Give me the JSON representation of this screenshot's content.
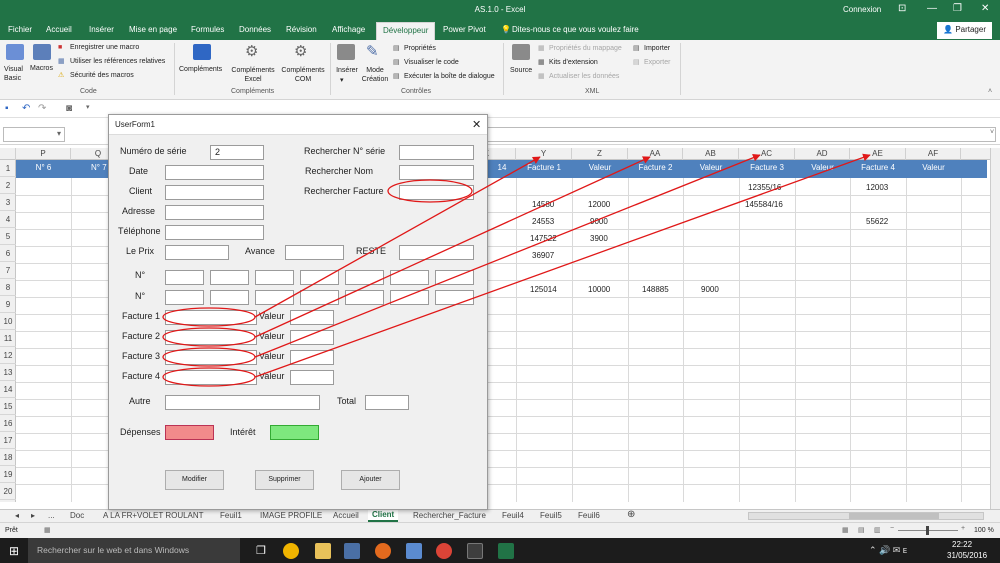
{
  "window": {
    "title": "AS.1.0 - Excel",
    "account": "Connexion",
    "controls": [
      "⊡",
      "—",
      "❐",
      "✕"
    ]
  },
  "ribbon_tabs": [
    "Fichier",
    "Accueil",
    "Insérer",
    "Mise en page",
    "Formules",
    "Données",
    "Révision",
    "Affichage",
    "Développeur",
    "Power Pivot",
    "Dites-nous ce que vous voulez faire"
  ],
  "share_label": "Partager",
  "ribbon": {
    "code": {
      "visual_basic": "Visual Basic",
      "macros": "Macros",
      "record": "Enregistrer une macro",
      "relative": "Utiliser les références relatives",
      "security": "Sécurité des macros",
      "group": "Code"
    },
    "addins": {
      "complements": "Compléments",
      "excel": "Compléments Excel",
      "com": "Compléments COM",
      "group": "Compléments"
    },
    "controls": {
      "insert": "Insérer",
      "design": "Mode Création",
      "properties": "Propriétés",
      "view_code": "Visualiser le code",
      "run_dialog": "Exécuter la boîte de dialogue",
      "group": "Contrôles"
    },
    "xml": {
      "source": "Source",
      "map_props": "Propriétés du mappage",
      "expansion": "Kits d'extension",
      "refresh": "Actualiser les données",
      "import": "Importer",
      "export": "Exporter",
      "group": "XML"
    }
  },
  "col_headers": [
    "P",
    "Q",
    "X",
    "Y",
    "Z",
    "AA",
    "AB",
    "AC",
    "AD",
    "AE",
    "AF"
  ],
  "row_numbers": [
    "1",
    "2",
    "3",
    "4",
    "5",
    "6",
    "7",
    "8",
    "9",
    "10",
    "11",
    "12",
    "13",
    "14",
    "15",
    "16",
    "17",
    "18",
    "19",
    "20"
  ],
  "header_cells": {
    "p": "N° 6",
    "q": "N° 7",
    "x": "14",
    "y": "Facture 1",
    "z": "Valeur",
    "aa": "Facture 2",
    "ab": "Valeur",
    "ac": "Facture 3",
    "ad": "Valeur",
    "ae": "Facture 4",
    "af": "Valeur"
  },
  "cells": {
    "ac2": "12355/16",
    "ae2": "12003",
    "y3": "14580",
    "z3": "12000",
    "ac3": "145584/16",
    "y4": "24553",
    "z4": "9000",
    "ae4": "55622",
    "y5": "147522",
    "z5": "3900",
    "y6": "36907",
    "y8": "125014",
    "z8": "10000",
    "aa8": "148885",
    "ab8": "9000"
  },
  "sheet_tabs": [
    "...",
    "Doc",
    "A LA FR+VOLET ROULANT",
    "Feuil1",
    "IMAGE PROFILE",
    "Accueil",
    "Client",
    "Rechercher_Facture",
    "Feuil4",
    "Feuil5",
    "Feuil6"
  ],
  "active_sheet": "Client",
  "status": {
    "ready": "Prêt",
    "zoom": "100 %"
  },
  "taskbar": {
    "search_placeholder": "Rechercher sur le web et dans Windows",
    "time": "22:22",
    "date": "31/05/2016"
  },
  "userform": {
    "title": "UserForm1",
    "labels": {
      "serial": "Numéro de série",
      "date": "Date",
      "client": "Client",
      "address": "Adresse",
      "phone": "Téléphone",
      "search_serial": "Rechercher N° série",
      "search_name": "Rechercher Nom",
      "search_invoice": "Rechercher Facture",
      "price": "Le Prix",
      "advance": "Avance",
      "rest": "RESTE",
      "no1": "N°",
      "no2": "N°",
      "invoice1": "Facture 1",
      "invoice2": "Facture 2",
      "invoice3": "Facture 3",
      "invoice4": "Facture 4",
      "value": "Valeur",
      "other": "Autre",
      "total": "Total",
      "expenses": "Dépenses",
      "interest": "Intérêt"
    },
    "serial_value": "2",
    "buttons": {
      "modify": "Modifier",
      "delete": "Supprimer",
      "add": "Ajouter"
    },
    "colors": {
      "expenses": "#f28b8b",
      "interest": "#7ee87e",
      "annotation": "#e01818"
    }
  }
}
